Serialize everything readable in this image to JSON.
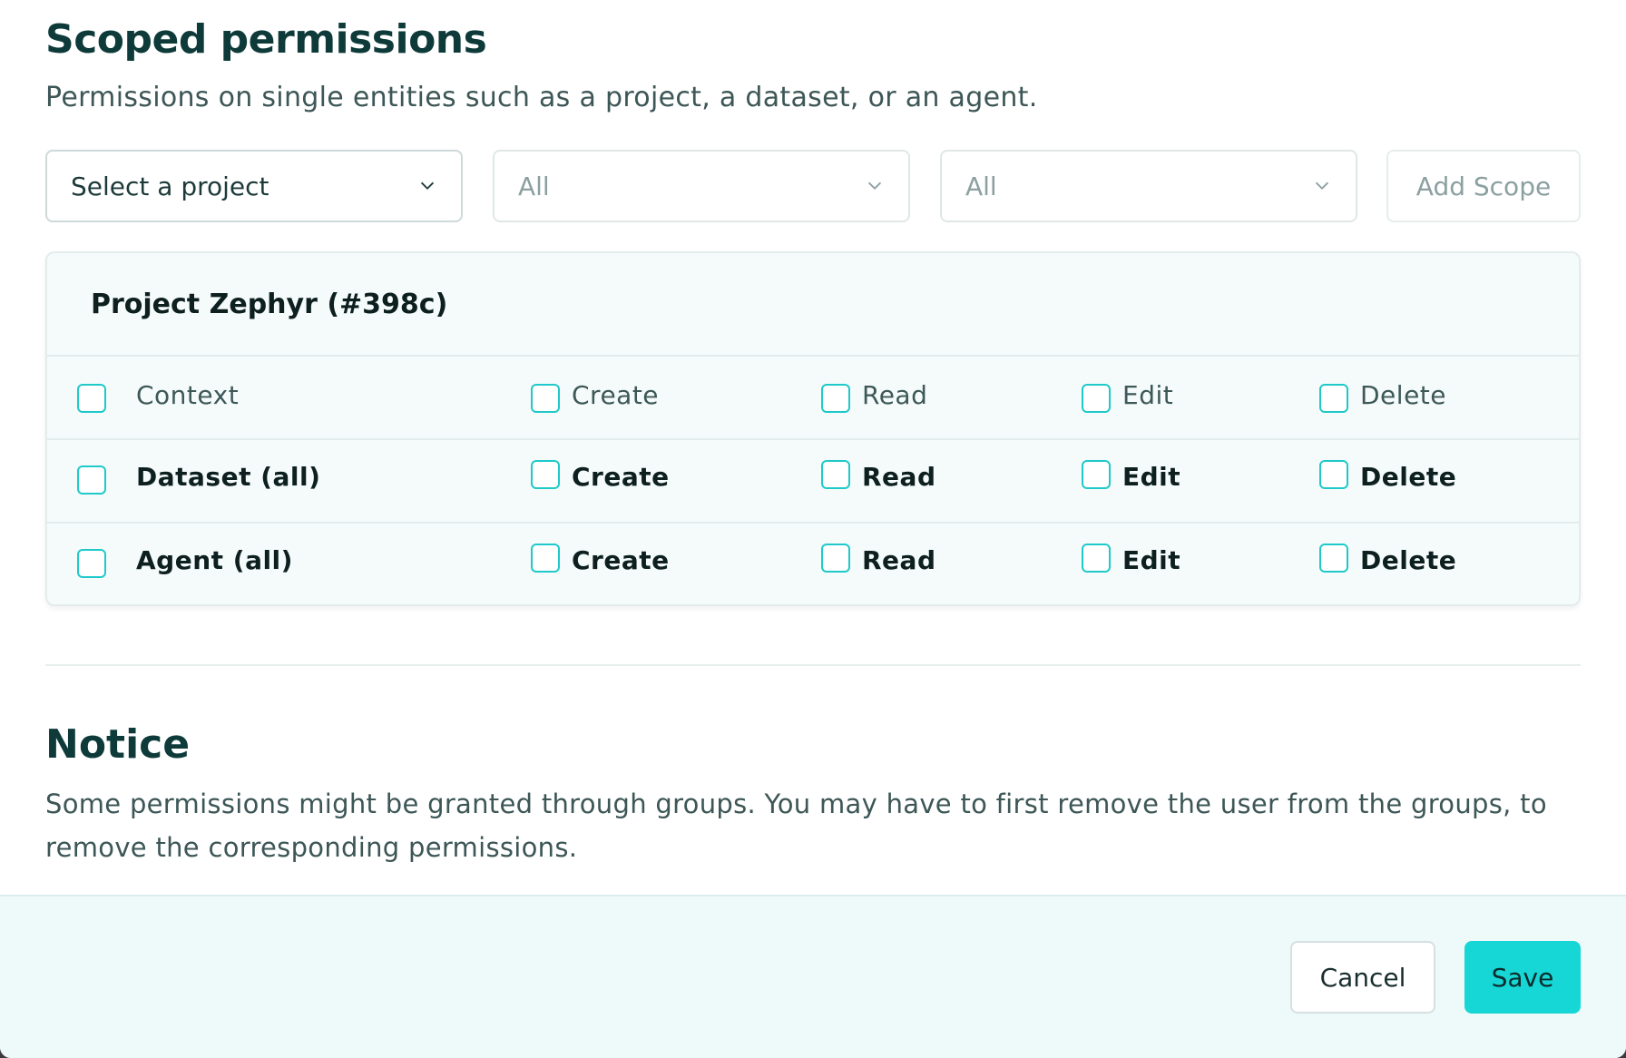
{
  "scoped": {
    "title": "Scoped permissions",
    "description": "Permissions on single entities such as a project, a dataset, or an agent."
  },
  "filters": {
    "project_select": "Select a project",
    "type_select": "All",
    "entity_select": "All",
    "add_scope_label": "Add Scope"
  },
  "scope": {
    "project_name": "Project Zephyr (#398c)",
    "rows": [
      {
        "label": "Context",
        "create": "Create",
        "read": "Read",
        "edit": "Edit",
        "delete": "Delete"
      },
      {
        "label": "Dataset (all)",
        "create": "Create",
        "read": "Read",
        "edit": "Edit",
        "delete": "Delete"
      },
      {
        "label": "Agent (all)",
        "create": "Create",
        "read": "Read",
        "edit": "Edit",
        "delete": "Delete"
      }
    ]
  },
  "notice": {
    "title": "Notice",
    "text": "Some permissions might be granted through groups. You may have to first remove the user from the groups, to remove the corresponding permissions."
  },
  "footer": {
    "cancel_label": "Cancel",
    "save_label": "Save"
  },
  "colors": {
    "accent": "#17d6d6",
    "checkbox_border": "#20c9c9",
    "heading": "#0e3a3a"
  }
}
